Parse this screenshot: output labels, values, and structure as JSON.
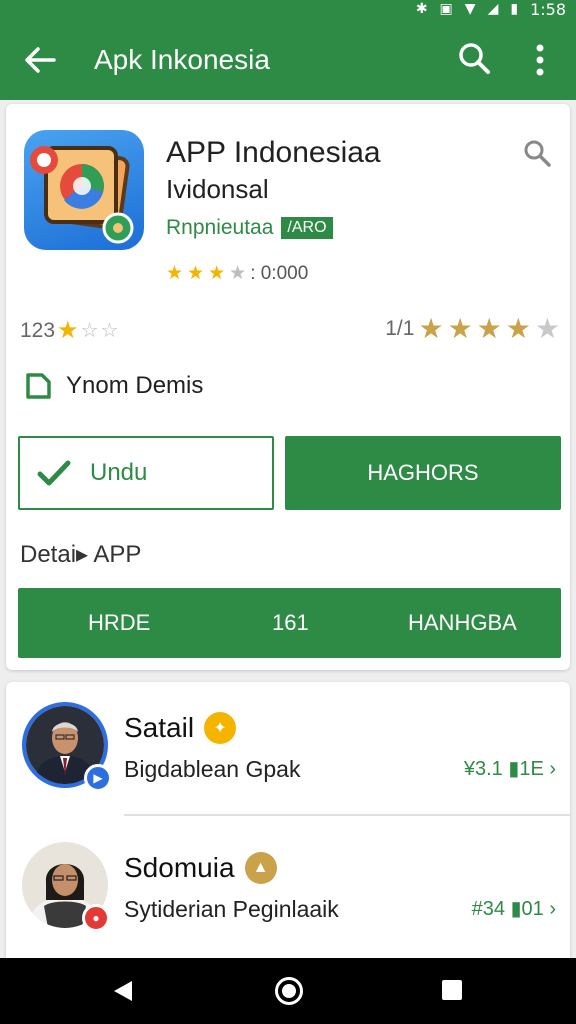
{
  "status_bar": {
    "time": "1:58"
  },
  "app_bar": {
    "title": "Apk Inkonesia"
  },
  "app": {
    "name": "APP Indonesiaa",
    "subtitle": "Ividonsal",
    "developer": "Rnpnieutaa",
    "badge": "/ARO",
    "rating_count": ": 0:000",
    "stats_left": "123",
    "stats_right": "1/1",
    "feature": "Ynom Demis"
  },
  "buttons": {
    "outline_label": "Undu",
    "fill_label": "HAGHORS"
  },
  "details": {
    "label": "Detai▸ APP",
    "bar_left": "HRDE",
    "bar_mid": "161",
    "bar_right": "HANHGBA"
  },
  "people": [
    {
      "name": "Satail",
      "subtitle": "Bigdablean Gpak",
      "stat": "¥3.1 ▮1E ›"
    },
    {
      "name": "Sdomuia",
      "subtitle": "Sytiderian Peginlaaik",
      "stat": "#34 ▮01 ›"
    }
  ],
  "colors": {
    "primary": "#2e8b45",
    "star": "#f4b400",
    "accent_blue": "#2d6ee0"
  }
}
